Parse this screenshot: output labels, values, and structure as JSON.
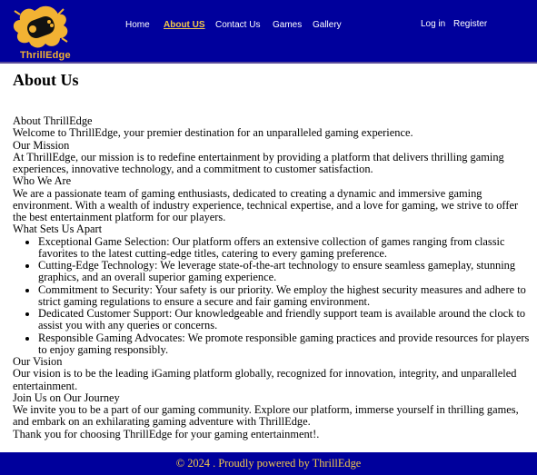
{
  "brand": {
    "name": "ThrillEdge"
  },
  "nav": {
    "home": "Home",
    "about": "About US",
    "contact": "Contact Us",
    "games": "Games",
    "gallery": "Gallery",
    "login": "Log in",
    "register": "Register"
  },
  "page": {
    "title": "About Us",
    "section_about": "About ThrillEdge",
    "welcome": "Welcome to ThrillEdge, your premier destination for an unparalleled gaming experience.",
    "mission_heading": "Our Mission",
    "mission_text": "At ThrillEdge, our mission is to redefine entertainment by providing a platform that delivers thrilling gaming experiences, innovative technology, and a commitment to customer satisfaction.",
    "who_heading": "Who We Are",
    "who_text": "We are a passionate team of gaming enthusiasts, dedicated to creating a dynamic and immersive gaming environment. With a wealth of industry experience, technical expertise, and a love for gaming, we strive to offer the best entertainment platform for our players.",
    "sets_heading": "What Sets Us Apart",
    "sets_items": [
      "Exceptional Game Selection: Our platform offers an extensive collection of games ranging from classic favorites to the latest cutting-edge titles, catering to every gaming preference.",
      "Cutting-Edge Technology: We leverage state-of-the-art technology to ensure seamless gameplay, stunning graphics, and an overall superior gaming experience.",
      "Commitment to Security: Your safety is our priority. We employ the highest security measures and adhere to strict gaming regulations to ensure a secure and fair gaming environment.",
      "Dedicated Customer Support: Our knowledgeable and friendly support team is available around the clock to assist you with any queries or concerns.",
      "Responsible Gaming Advocates: We promote responsible gaming practices and provide resources for players to enjoy gaming responsibly."
    ],
    "vision_heading": "Our Vision",
    "vision_text": "Our vision is to be the leading iGaming platform globally, recognized for innovation, integrity, and unparalleled entertainment.",
    "join_heading": "Join Us on Our Journey",
    "join_text": "We invite you to be a part of our gaming community. Explore our platform, immerse yourself in thrilling games, and embark on an exhilarating gaming adventure with ThrillEdge.",
    "thanks": "Thank you for choosing ThrillEdge for your gaming entertainment!."
  },
  "footer": {
    "text": "© 2024 . Proudly powered by ThrillEdge"
  },
  "colors": {
    "header_bg": "#00009c",
    "accent": "#f2c84b",
    "logo_orange": "#f2b233"
  },
  "icons": {
    "logo": "gamepad-splash-logo"
  }
}
